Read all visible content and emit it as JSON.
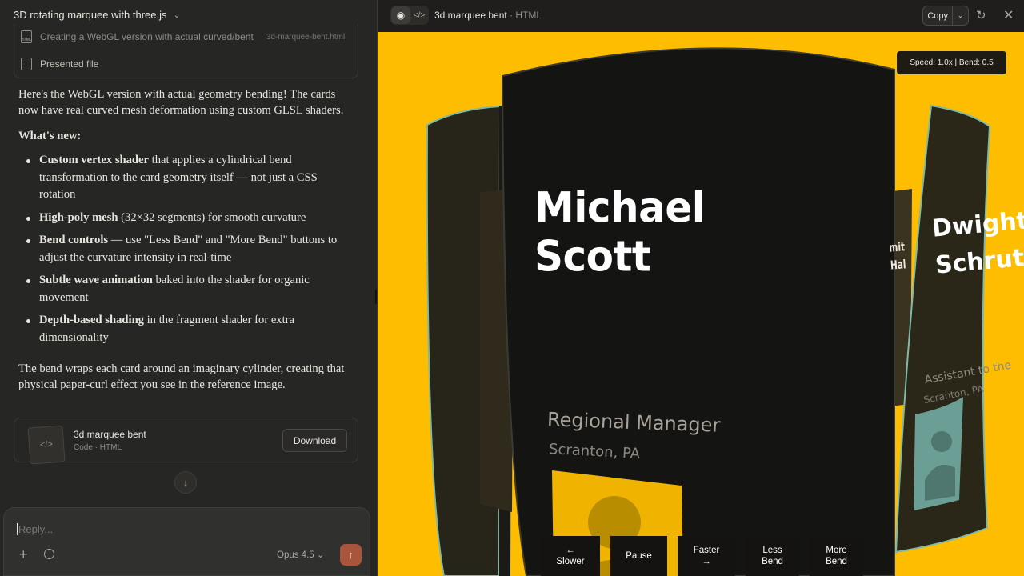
{
  "chat": {
    "title": "3D rotating marquee with three.js",
    "tool_step": {
      "text": "Creating a WebGL version with actual curved/bent",
      "file": "3d-marquee-bent.html"
    },
    "presented": "Presented file",
    "intro": "Here's the WebGL version with actual geometry bending! The cards now have real curved mesh deformation using custom GLSL shaders.",
    "whats_new": "What's new:",
    "bullets": [
      {
        "bold": "Custom vertex shader",
        "rest": " that applies a cylindrical bend transformation to the card geometry itself — not just a CSS rotation"
      },
      {
        "bold": "High-poly mesh",
        "rest": " (32×32 segments) for smooth curvature"
      },
      {
        "bold": "Bend controls",
        "rest": " — use \"Less Bend\" and \"More Bend\" buttons to adjust the curvature intensity in real-time"
      },
      {
        "bold": "Subtle wave animation",
        "rest": " baked into the shader for organic movement"
      },
      {
        "bold": "Depth-based shading",
        "rest": " in the fragment shader for extra dimensionality"
      }
    ],
    "closing": "The bend wraps each card around an imaginary cylinder, creating that physical paper-curl effect you see in the reference image.",
    "artifact": {
      "title": "3d marquee bent",
      "subtitle": "Code · HTML",
      "download": "Download"
    },
    "composer": {
      "placeholder": "Reply...",
      "model": "Opus 4.5"
    }
  },
  "preview": {
    "title": "3d marquee bent",
    "subtitle": " · HTML",
    "copy": "Copy",
    "speed_badge": "Speed: 1.0x | Bend: 0.5",
    "cards": {
      "front": {
        "name_line1": "Michael",
        "name_line2": "Scott",
        "role": "Regional Manager",
        "location": "Scranton, PA"
      },
      "right": {
        "name_line1": "Dwight",
        "name_line2": "Schrute",
        "role": "Assistant to the",
        "location": "Scranton, PA"
      },
      "mid": {
        "name_line1": "mit",
        "name_line2": "Hal"
      }
    },
    "controls": [
      {
        "line1": "←",
        "line2": "Slower"
      },
      {
        "line1": "Pause",
        "line2": ""
      },
      {
        "line1": "Faster",
        "line2": "→"
      },
      {
        "line1": "Less",
        "line2": "Bend"
      },
      {
        "line1": "More",
        "line2": "Bend"
      }
    ]
  },
  "colors": {
    "stage_bg": "#ffbd00",
    "card_dark": "#141412",
    "accent_send": "#a9553e",
    "edge_teal": "#7fb9a8"
  },
  "icons": [
    "chevron-down-icon",
    "html-file-icon",
    "file-icon",
    "code-icon",
    "arrow-down-icon",
    "plus-icon",
    "clock-icon",
    "arrow-up-icon",
    "eye-icon",
    "refresh-icon",
    "close-icon"
  ]
}
